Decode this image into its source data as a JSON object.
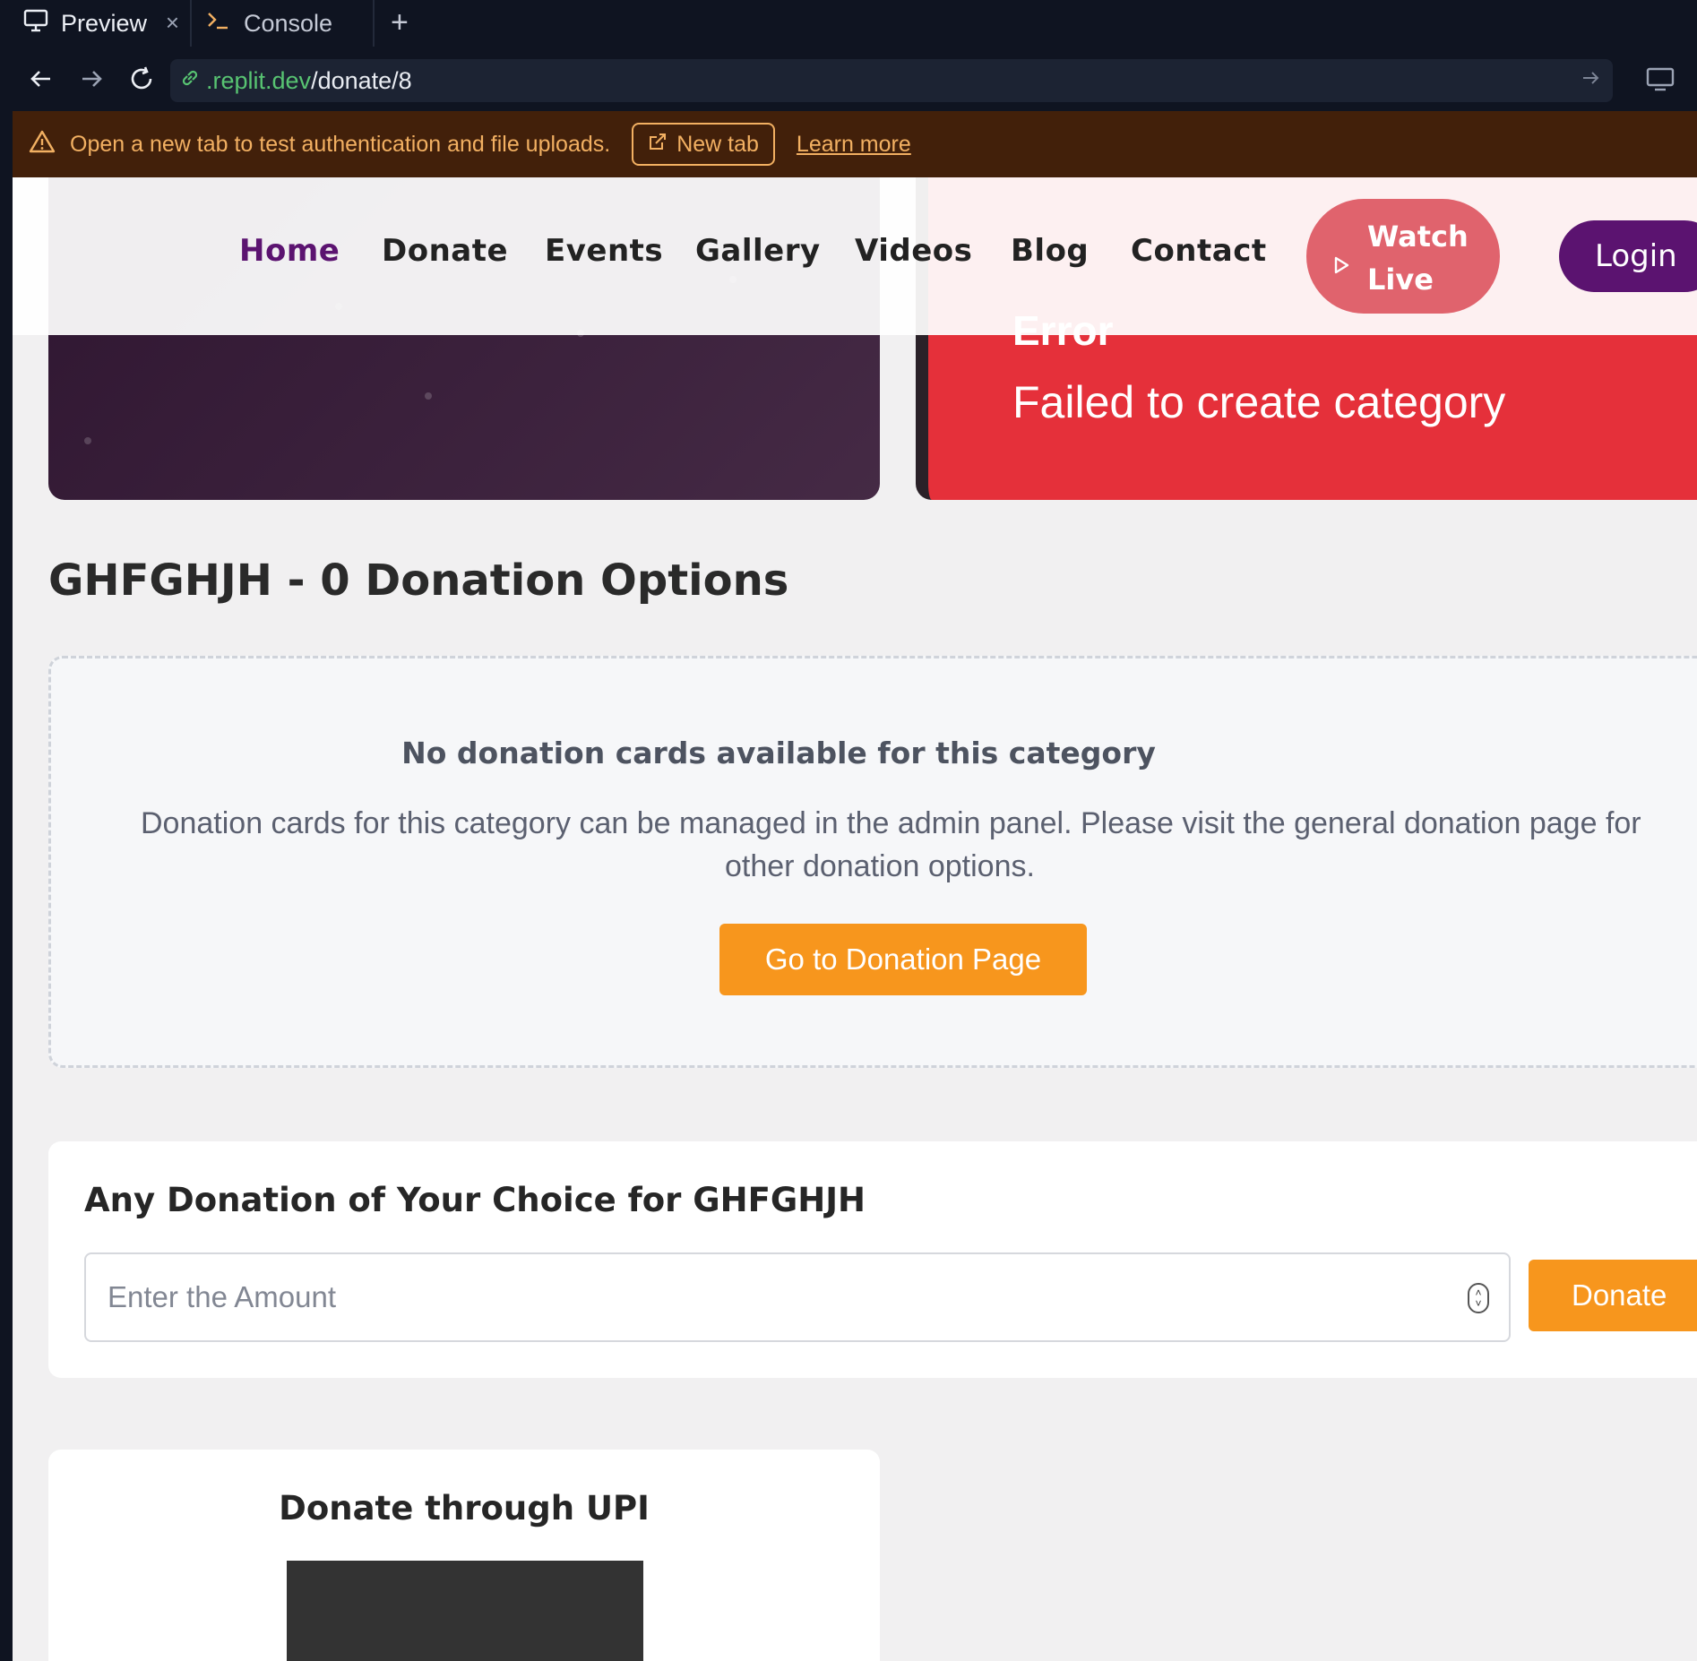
{
  "browser": {
    "tabs": [
      {
        "label": "Preview",
        "icon": "monitor-icon"
      },
      {
        "label": "Console",
        "icon": "terminal-icon"
      }
    ],
    "url": {
      "domain": ".replit.dev",
      "path": "/donate/8"
    },
    "banner": {
      "message": "Open a new tab to test authentication and file uploads.",
      "new_tab_label": "New tab",
      "learn_more_label": "Learn more"
    }
  },
  "nav": {
    "items": [
      "Home",
      "Donate",
      "Events",
      "Gallery",
      "Videos",
      "Blog",
      "Contact"
    ],
    "active": "Home",
    "watch_live_line1": "Watch",
    "watch_live_line2": "Live",
    "login_label": "Login"
  },
  "toast": {
    "title": "Error",
    "message": "Failed to create category"
  },
  "section": {
    "title": "GHFGHJH - 0 Donation Options"
  },
  "empty_state": {
    "title": "No donation cards available for this category",
    "description_line1": "Donation cards for this category can be managed in the admin panel. Please visit the general donation page for",
    "description_line2": "other donation options.",
    "button_label": "Go to Donation Page"
  },
  "custom_donation": {
    "title": "Any Donation of Your Choice for GHFGHJH",
    "placeholder": "Enter the Amount",
    "button_label": "Donate"
  },
  "upi": {
    "title": "Donate through UPI"
  },
  "colors": {
    "brand_purple": "#5b1370",
    "accent_orange": "#f7961d",
    "error_red": "#e5303a",
    "watch_live_pink": "#e0636d"
  }
}
